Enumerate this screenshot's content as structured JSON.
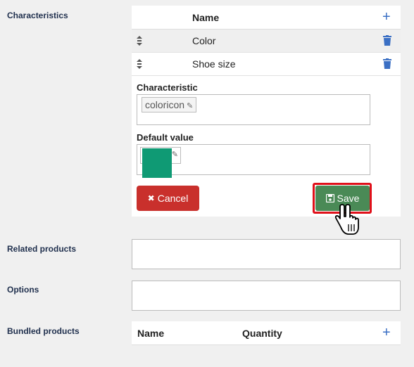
{
  "sections": {
    "characteristics": "Characteristics",
    "related_products": "Related products",
    "options": "Options",
    "bundled_products": "Bundled products"
  },
  "characteristics_table": {
    "header_name": "Name",
    "add_icon": "+",
    "rows": [
      {
        "label": "Color"
      },
      {
        "label": "Shoe size"
      }
    ]
  },
  "editor": {
    "characteristic_label": "Characteristic",
    "characteristic_value": "coloricon",
    "default_value_label": "Default value",
    "default_color": "#0f9a74",
    "cancel_label": "Cancel",
    "save_label": "Save",
    "cancel_icon": "✖",
    "save_icon": "💾"
  },
  "bundled_table": {
    "col_name": "Name",
    "col_quantity": "Quantity",
    "add_icon": "+"
  },
  "colors": {
    "accent": "#3a6fc4",
    "danger": "#c9302c",
    "success": "#4a8a56",
    "highlight": "#e0101a"
  }
}
